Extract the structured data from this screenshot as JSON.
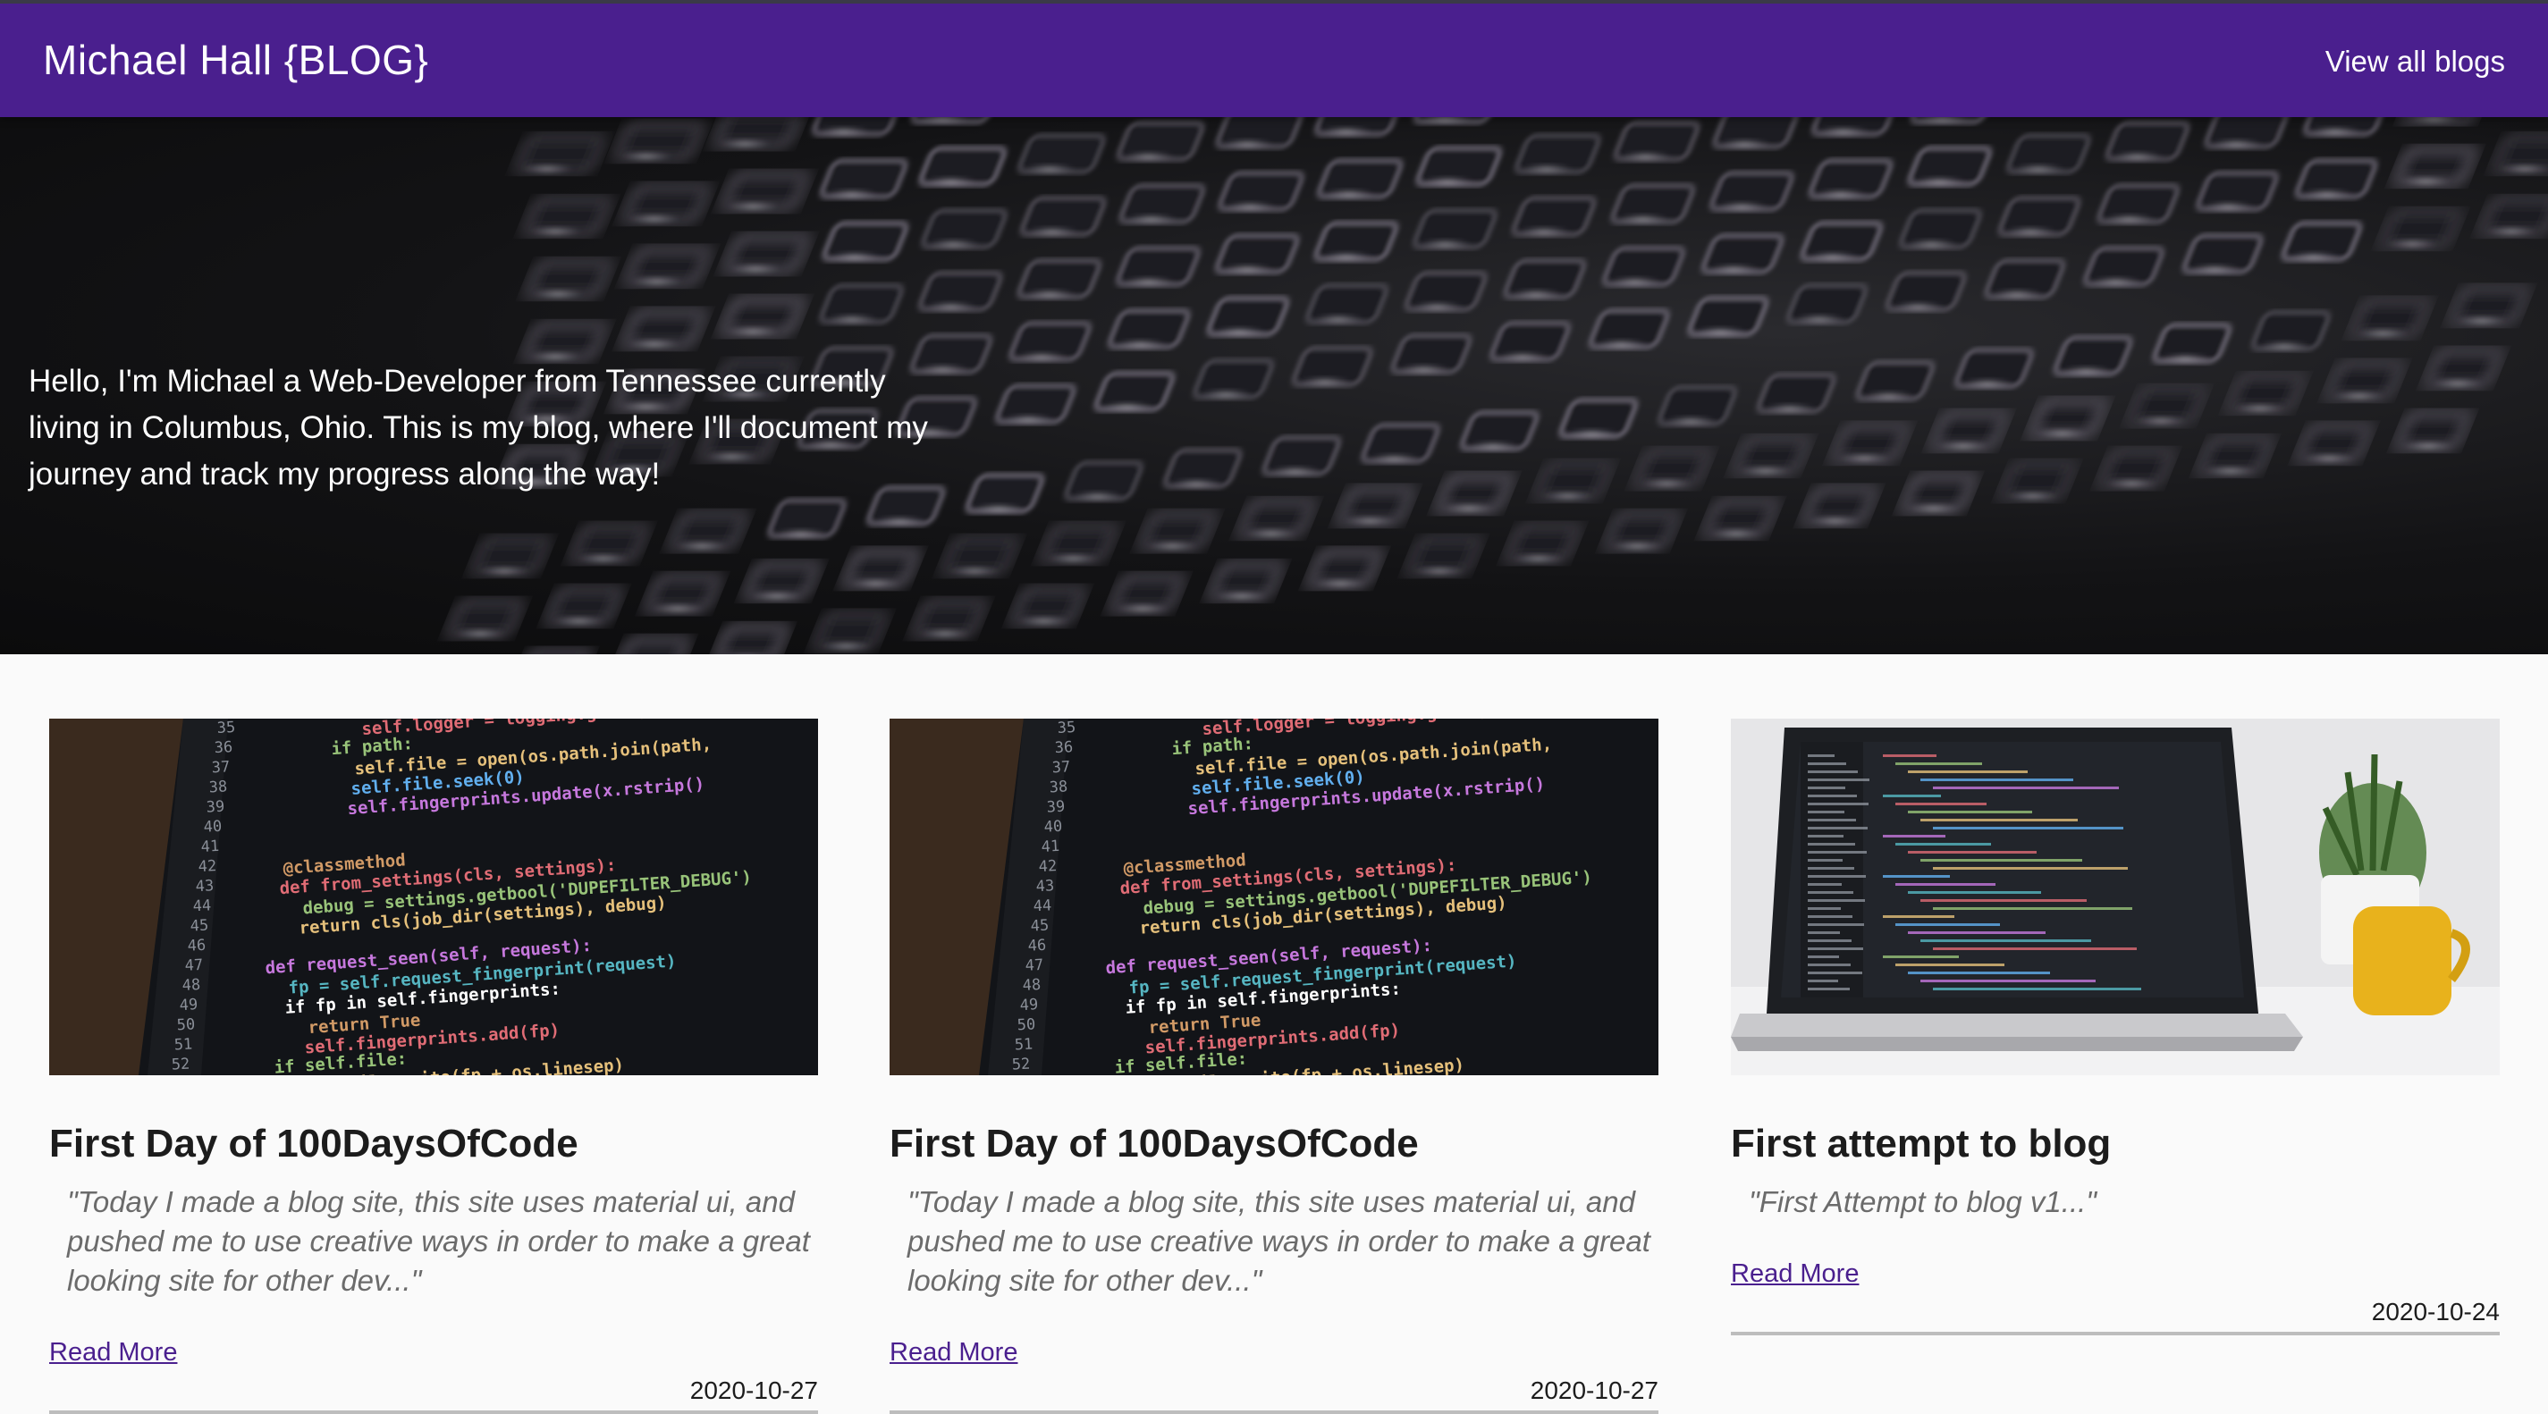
{
  "header": {
    "title": "Michael Hall {BLOG}",
    "view_all_label": "View all blogs",
    "color": "#4a1f8e"
  },
  "hero": {
    "text": "Hello, I'm Michael a Web-Developer from Tennessee currently living in Columbus, Ohio. This is my blog, where I'll document my journey and track my progress along the way!"
  },
  "posts": [
    {
      "title": "First Day of 100DaysOfCode",
      "excerpt": "\"Today I made a blog site, this site uses material ui, and pushed me to use creative ways in order to make a great looking site for other dev...\"",
      "read_more": "Read More",
      "date": "2020-10-27",
      "image": "code-editor-closeup"
    },
    {
      "title": "First Day of 100DaysOfCode",
      "excerpt": "\"Today I made a blog site, this site uses material ui, and pushed me to use creative ways in order to make a great looking site for other dev...\"",
      "read_more": "Read More",
      "date": "2020-10-27",
      "image": "code-editor-closeup"
    },
    {
      "title": "First attempt to blog",
      "excerpt": "\"First Attempt to blog v1...\"",
      "read_more": "Read More",
      "date": "2020-10-24",
      "image": "laptop-on-desk"
    }
  ],
  "code_image_text": {
    "line_numbers": [
      "35",
      "36",
      "37",
      "38",
      "39",
      "40",
      "41",
      "42",
      "43",
      "44",
      "45",
      "46",
      "47",
      "48",
      "49",
      "50",
      "51",
      "52"
    ],
    "lines": [
      "self.logger = logging.getLogger",
      "if path:",
      "self.file = open(os.path.join(path,",
      "self.file.seek(0)",
      "self.fingerprints.update(x.rstrip()",
      "",
      "",
      "@classmethod",
      "def from_settings(cls, settings):",
      "debug = settings.getbool('DUPEFILTER_DEBUG')",
      "return cls(job_dir(settings), debug)",
      "",
      "def request_seen(self, request):",
      "fp = self.request_fingerprint(request)",
      "if fp in self.fingerprints:",
      "return True",
      "self.fingerprints.add(fp)",
      "if self.file:",
      "self.file.write(fp + os.linesep)"
    ]
  }
}
